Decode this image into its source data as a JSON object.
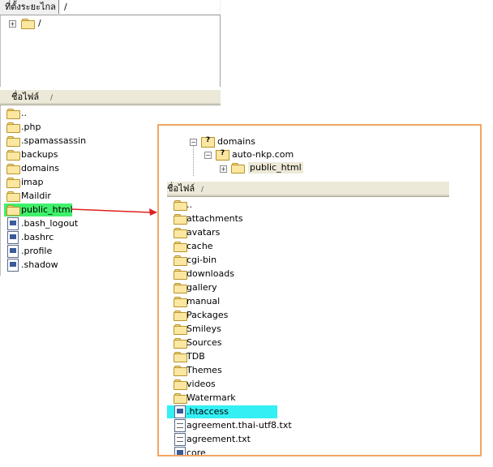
{
  "left": {
    "remote_site_label": "ที่ตั้งระยะไกล",
    "remote_path": "/",
    "tree_root": "/",
    "header_filename": "ชื่อไฟล์",
    "header_sort": "/",
    "items": [
      {
        "name": "..",
        "icon": "folder-icon"
      },
      {
        "name": ".php",
        "icon": "folder-icon"
      },
      {
        "name": ".spamassassin",
        "icon": "folder-icon"
      },
      {
        "name": "backups",
        "icon": "folder-icon"
      },
      {
        "name": "domains",
        "icon": "folder-icon"
      },
      {
        "name": "imap",
        "icon": "folder-icon"
      },
      {
        "name": "Maildir",
        "icon": "folder-icon"
      },
      {
        "name": "public_html",
        "icon": "folder-icon"
      },
      {
        "name": ".bash_logout",
        "icon": "file-icon"
      },
      {
        "name": ".bashrc",
        "icon": "file-icon"
      },
      {
        "name": ".profile",
        "icon": "file-icon"
      },
      {
        "name": ".shadow",
        "icon": "file-icon"
      }
    ],
    "selected": "public_html"
  },
  "right": {
    "tree": [
      {
        "name": "domains",
        "icon": "question-folder-icon"
      },
      {
        "name": "auto-nkp.com",
        "icon": "question-folder-icon"
      },
      {
        "name": "public_html",
        "icon": "folder-icon"
      }
    ],
    "header_filename": "ชื่อไฟล์",
    "header_sort": "/",
    "items": [
      {
        "name": "..",
        "icon": "folder-icon"
      },
      {
        "name": "attachments",
        "icon": "folder-icon"
      },
      {
        "name": "avatars",
        "icon": "folder-icon"
      },
      {
        "name": "cache",
        "icon": "folder-icon"
      },
      {
        "name": "cgi-bin",
        "icon": "folder-icon"
      },
      {
        "name": "downloads",
        "icon": "folder-icon"
      },
      {
        "name": "gallery",
        "icon": "folder-icon"
      },
      {
        "name": "manual",
        "icon": "folder-icon"
      },
      {
        "name": "Packages",
        "icon": "folder-icon"
      },
      {
        "name": "Smileys",
        "icon": "folder-icon"
      },
      {
        "name": "Sources",
        "icon": "folder-icon"
      },
      {
        "name": "TDB",
        "icon": "folder-icon"
      },
      {
        "name": "Themes",
        "icon": "folder-icon"
      },
      {
        "name": "videos",
        "icon": "folder-icon"
      },
      {
        "name": "Watermark",
        "icon": "folder-icon"
      },
      {
        "name": ".htaccess",
        "icon": "file-icon"
      },
      {
        "name": "agreement.thai-utf8.txt",
        "icon": "text-file-icon"
      },
      {
        "name": "agreement.txt",
        "icon": "text-file-icon"
      },
      {
        "name": "core",
        "icon": "file-icon"
      }
    ],
    "selected": ".htaccess"
  },
  "colors": {
    "left_highlight": "#3ef06a",
    "right_highlight": "#33f0f4",
    "callout_border": "#f4a460",
    "arrow": "#e02020"
  }
}
